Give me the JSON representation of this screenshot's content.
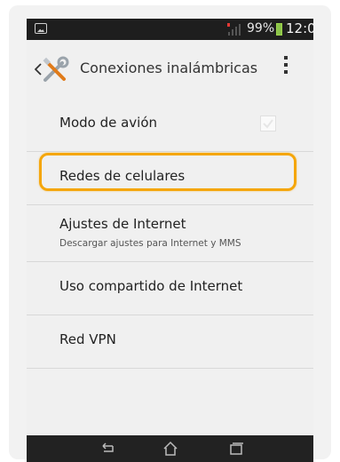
{
  "status_bar": {
    "battery_percent": "99%",
    "time": "12:00"
  },
  "action_bar": {
    "title": "Conexiones inalámbricas"
  },
  "settings_list": [
    {
      "label": "Modo de avión",
      "checked": true
    },
    {
      "label": "Redes de celulares",
      "highlighted": true
    },
    {
      "label": "Ajustes de Internet",
      "sub": "Descargar ajustes para Internet y MMS"
    },
    {
      "label": "Uso compartido de Internet"
    },
    {
      "label": "Red VPN"
    }
  ],
  "colors": {
    "highlight": "#f5a60a",
    "status_bar_bg": "#1e1e1e",
    "nav_bar_bg": "#222222",
    "battery": "#8bc34a",
    "signal_alert": "#e53935"
  },
  "nav_bar": {
    "icons": [
      "back-icon",
      "home-icon",
      "recent-apps-icon"
    ]
  }
}
